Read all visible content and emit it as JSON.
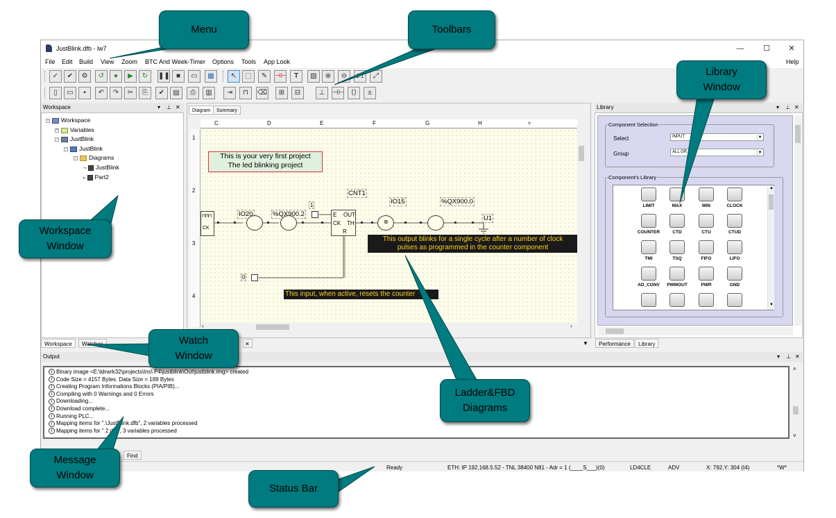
{
  "window": {
    "title": "JustBlink.dfb - lw7",
    "controls": [
      "—",
      "☐",
      "✕"
    ]
  },
  "menu": [
    "File",
    "Edit",
    "Build",
    "View",
    "Zoom",
    "BTC And Week-Timer",
    "Options",
    "Tools",
    "App Look",
    "Help"
  ],
  "workspace": {
    "title": "Workspace",
    "tree": {
      "root": "Workspace",
      "variables": "Variables",
      "project": "JustBlink",
      "program": "JustBlink",
      "diagrams": "Diagrams",
      "diagram1": "JustBlink",
      "diagram2": "Part2"
    },
    "tabs": [
      "Workspace",
      "Watches"
    ]
  },
  "editor": {
    "tabs": [
      "Diagram",
      "Summary"
    ],
    "columns": [
      "C",
      "D",
      "E",
      "F",
      "G",
      "H"
    ],
    "rows": [
      "1",
      "2",
      "3",
      "4"
    ],
    "comment1_line1": "This is your very first project",
    "comment1_line2": "The led blinking project",
    "counter_name": "CNT1",
    "var_io20": "IO20",
    "var_qx9002": "%QX900.2",
    "var_io15": "IO15",
    "var_qx9000": "%QX900.0",
    "const_1": "1",
    "const_0": "0",
    "coil_label": "U1",
    "clock_label": "CK",
    "counter_pins": {
      "e": "E",
      "ck": "CK",
      "r": "R",
      "out": "OUT",
      "th": "TH"
    },
    "comment_output_line1": "This output blinks for a single cycle after a number of clock",
    "comment_output_line2": "pulses as programmed in the counter component",
    "comment_input": "This input, when active, resets the counter",
    "bottom_close": "✕"
  },
  "library": {
    "title": "Library",
    "component_selection": "Component Selection",
    "select_label": "Select",
    "select_value": "INPUT",
    "group_label": "Group",
    "group_value": "ALL GR",
    "components_library": "Component's Library",
    "items": [
      {
        "name": "LIMIT",
        "icon": "limit"
      },
      {
        "name": "MAX",
        "icon": "max"
      },
      {
        "name": "MIN",
        "icon": "min"
      },
      {
        "name": "CLOCK",
        "icon": "clock"
      },
      {
        "name": "COUNTER",
        "icon": "counter"
      },
      {
        "name": "CTD",
        "icon": "ctd"
      },
      {
        "name": "CTU",
        "icon": "ctu"
      },
      {
        "name": "CTUD",
        "icon": "ctud"
      },
      {
        "name": "TMI",
        "icon": "tmi"
      },
      {
        "name": "TSQ",
        "icon": "tsq"
      },
      {
        "name": "FIFO",
        "icon": "fifo"
      },
      {
        "name": "LIFO",
        "icon": "lifo"
      },
      {
        "name": "AD_CONV",
        "icon": "adconv"
      },
      {
        "name": "PWMOUT",
        "icon": "pwmout"
      },
      {
        "name": "PWR",
        "icon": "pwr"
      },
      {
        "name": "GND",
        "icon": "gnd"
      },
      {
        "name": "",
        "icon": "ladder1"
      },
      {
        "name": "",
        "icon": "ladder2"
      },
      {
        "name": "",
        "icon": "block1"
      },
      {
        "name": "",
        "icon": "block2"
      }
    ],
    "tabs": [
      "Performance",
      "Library"
    ]
  },
  "output": {
    "title": "Output",
    "lines": [
      "Binary image <E:\\ldrwrk32\\projects\\Ins\\                                    P4\\justblink\\Out\\justblink.img> created",
      "Code Size = 4157 Bytes. Data Size = 189 Bytes",
      "Creating Program Informations Blocks (PIA/PIB)...",
      "Compiling with 0 Warnings and 0 Errors",
      "Downloading...",
      "Download complete...",
      "Running PLC...",
      "Mapping items for \".\\JustBlink.dfb\", 2 variables processed",
      "Mapping items for \"        2.dfb\", 3 variables processed"
    ],
    "tabs": [
      "Find"
    ]
  },
  "statusbar": {
    "ready": "Ready",
    "connection": "ETH: IP 192.168.5.52 - TNL 38400 N81 - Adr = 1 (____S___)(0)",
    "device": "LD4CLE",
    "mode": "ADV",
    "coords": "X: 792,Y: 304 (I4)",
    "flag": "*W*"
  },
  "callouts": {
    "menu": "Menu",
    "toolbars": "Toolbars",
    "library_window": "Library Window",
    "workspace_window": "Workspace Window",
    "watch_window": "Watch Window",
    "ladder_fbd": "Ladder&FBD Diagrams",
    "message_window": "Message Window",
    "status_bar": "Status Bar"
  },
  "colors": {
    "callout_fill": "#007b7f",
    "diagram_bg": "#fdfdea",
    "comment_bg": "#1a1a1a",
    "comment_text": "#ffd21f",
    "comment1_bg": "#dff0df",
    "library_panel_bg": "#d7d7f0"
  }
}
